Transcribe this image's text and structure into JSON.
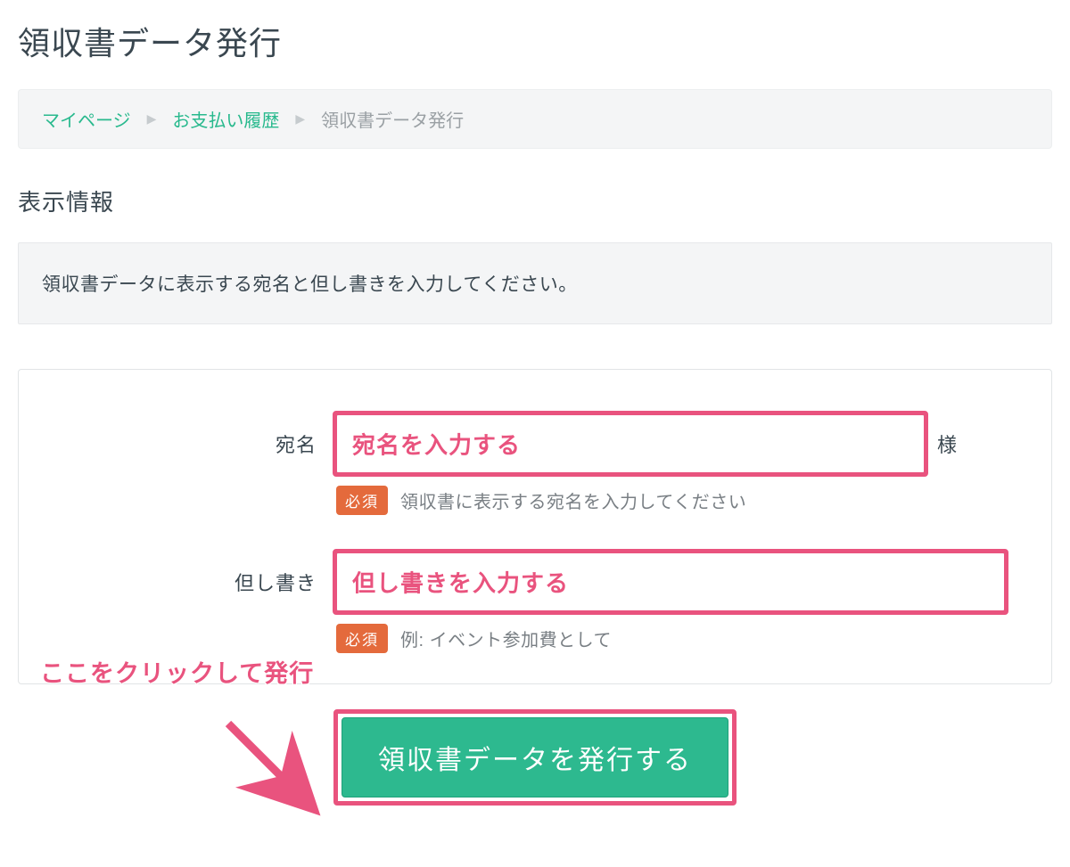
{
  "page": {
    "title": "領収書データ発行",
    "section_title": "表示情報",
    "info": "領収書データに表示する宛名と但し書きを入力してください。"
  },
  "breadcrumb": {
    "mypage": "マイページ",
    "history": "お支払い履歴",
    "current": "領収書データ発行"
  },
  "form": {
    "name": {
      "label": "宛名",
      "suffix": "様",
      "required_badge": "必須",
      "help": "領収書に表示する宛名を入力してください",
      "annotation": "宛名を入力する"
    },
    "memo": {
      "label": "但し書き",
      "required_badge": "必須",
      "help": "例: イベント参加費として",
      "annotation": "但し書きを入力する"
    },
    "submit_label": "領収書データを発行する"
  },
  "callout": {
    "text": "ここをクリックして発行"
  },
  "colors": {
    "accent_green": "#2db98f",
    "annotation_pink": "#e9537e",
    "required_orange": "#e46a3c"
  }
}
